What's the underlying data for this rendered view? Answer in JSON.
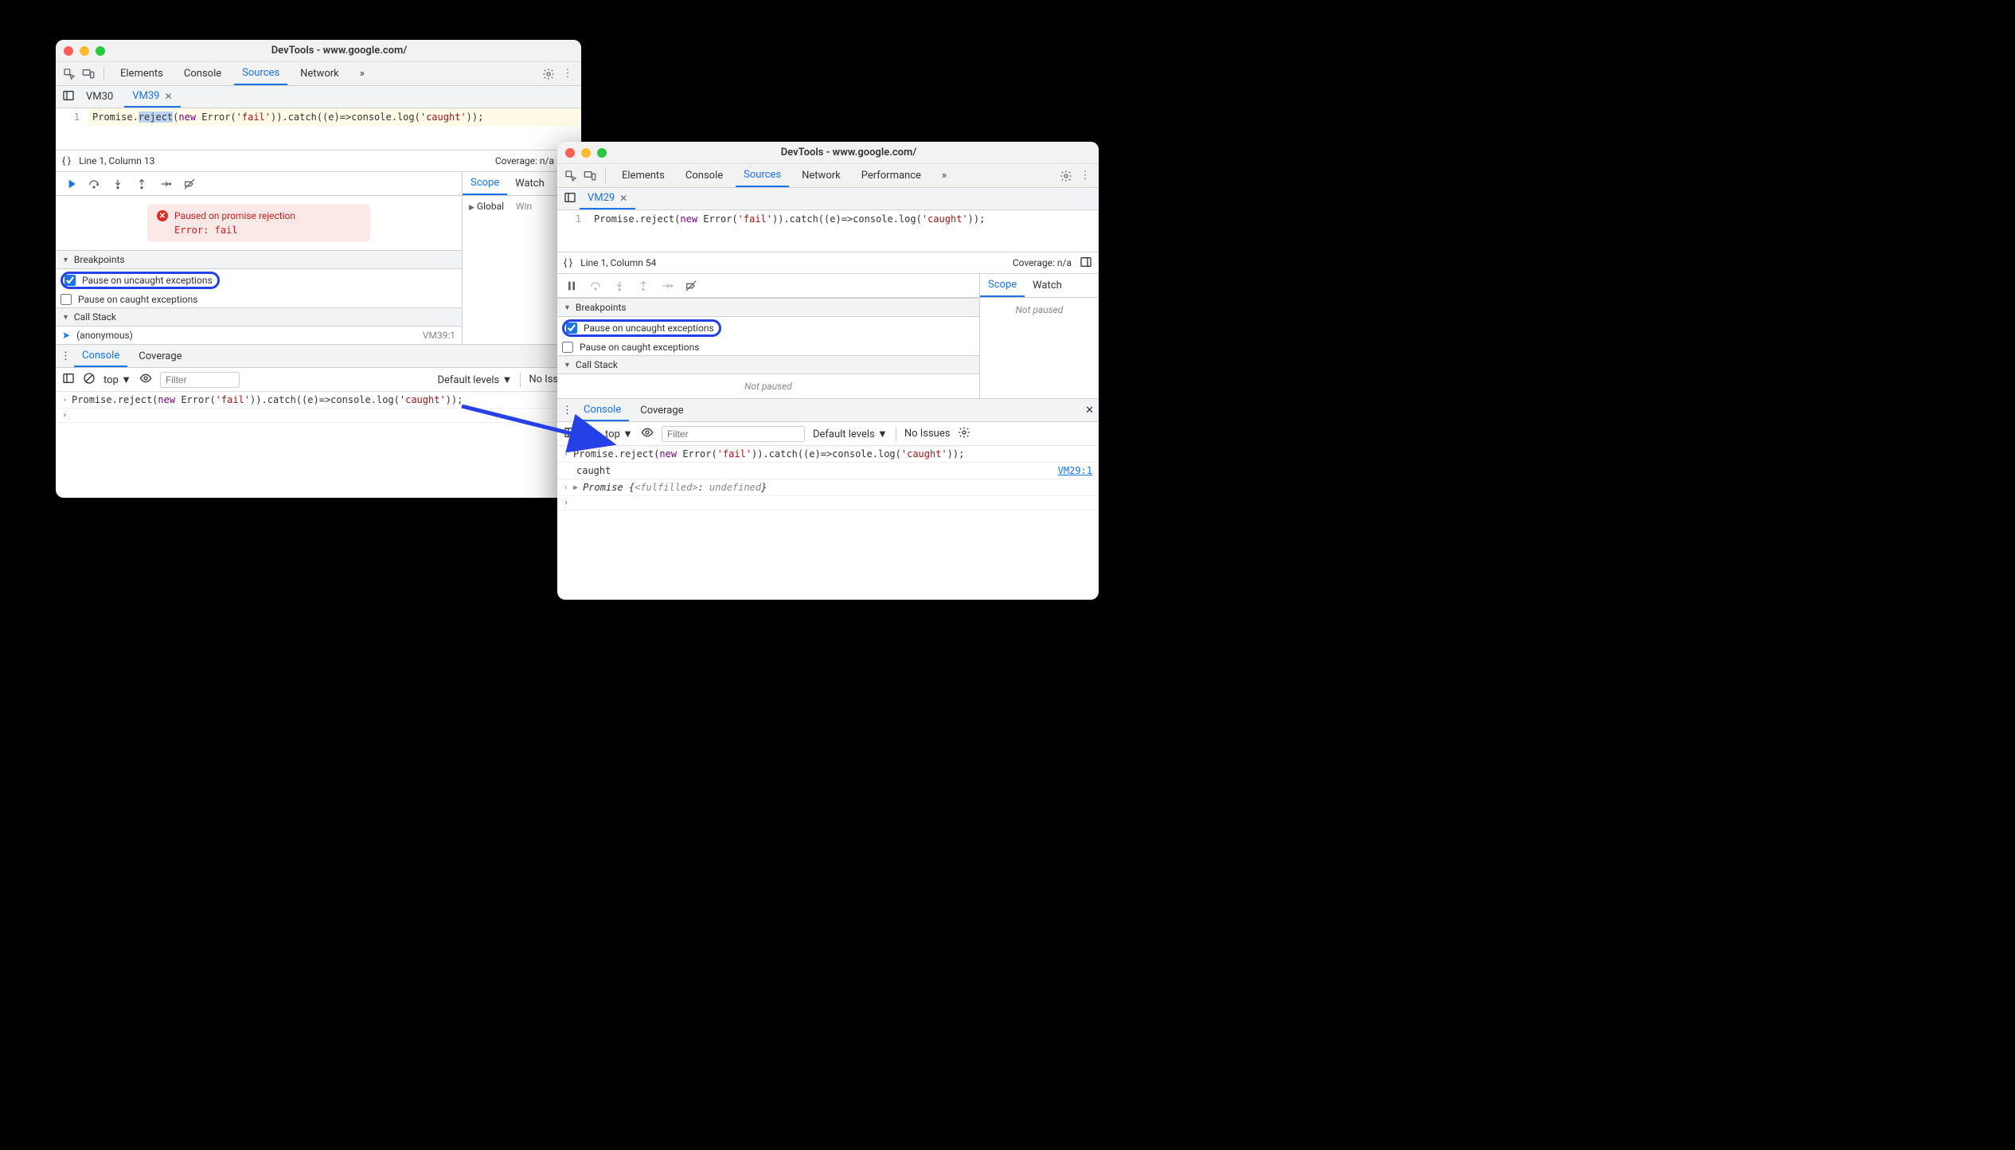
{
  "left": {
    "title": "DevTools - www.google.com/",
    "tabs": [
      "Elements",
      "Console",
      "Sources",
      "Network"
    ],
    "active_tab": "Sources",
    "more_glyph": "»",
    "file_tabs": {
      "inactive": "VM30",
      "active": "VM39"
    },
    "code": {
      "line_no": "1",
      "segments": {
        "a": "Promise.",
        "reject_sel": "reject",
        "b": "(",
        "new": "new",
        "c": " Error(",
        "str1": "'fail'",
        "d": ")).catch((e)=>console.log(",
        "str2": "'caught'",
        "e": "));"
      }
    },
    "status": {
      "cursor": "Line 1, Column 13",
      "coverage": "Coverage: n/a"
    },
    "pause_msg": {
      "head": "Paused on promise rejection",
      "detail": "Error: fail"
    },
    "breakpoints": {
      "heading": "Breakpoints",
      "uncaught": "Pause on uncaught exceptions",
      "caught": "Pause on caught exceptions"
    },
    "callstack": {
      "heading": "Call Stack",
      "frame": "(anonymous)",
      "loc": "VM39:1"
    },
    "scope": {
      "tabs": [
        "Scope",
        "Watch"
      ],
      "global": "Global",
      "win": "Win"
    },
    "drawer": {
      "tabs": [
        "Console",
        "Coverage"
      ]
    },
    "console_tb": {
      "ctx": "top",
      "filter_ph": "Filter",
      "levels": "Default levels",
      "issues": "No Issues"
    },
    "console": {
      "segments": {
        "a": "Promise.reject(",
        "new": "new",
        "b": " Error(",
        "str1": "'fail'",
        "c": ")).catch((e)=>console.log(",
        "str2": "'caught'",
        "d": "));"
      }
    }
  },
  "right": {
    "title": "DevTools - www.google.com/",
    "tabs": [
      "Elements",
      "Console",
      "Sources",
      "Network",
      "Performance"
    ],
    "active_tab": "Sources",
    "more_glyph": "»",
    "file_tabs": {
      "active": "VM29"
    },
    "code": {
      "line_no": "1",
      "segments": {
        "a": "Promise.reject(",
        "new": "new",
        "b": " Error(",
        "str1": "'fail'",
        "c": ")).catch((e)=>console.log(",
        "str2": "'caught'",
        "d": "));"
      }
    },
    "status": {
      "cursor": "Line 1, Column 54",
      "coverage": "Coverage: n/a"
    },
    "breakpoints": {
      "heading": "Breakpoints",
      "uncaught": "Pause on uncaught exceptions",
      "caught": "Pause on caught exceptions"
    },
    "callstack": {
      "heading": "Call Stack",
      "not_paused": "Not paused"
    },
    "scope": {
      "tabs": [
        "Scope",
        "Watch"
      ],
      "not_paused": "Not paused"
    },
    "drawer": {
      "tabs": [
        "Console",
        "Coverage"
      ]
    },
    "console_tb": {
      "ctx": "top",
      "filter_ph": "Filter",
      "levels": "Default levels",
      "issues": "No Issues"
    },
    "console": {
      "row1": {
        "a": "Promise.reject(",
        "new": "new",
        "b": " Error(",
        "str1": "'fail'",
        "c": ")).catch((e)=>console.log(",
        "str2": "'caught'",
        "d": "));"
      },
      "row2_text": "caught",
      "row2_link": "VM29:1",
      "row3": {
        "a": "Promise {",
        "b": "<fulfilled>",
        "c": ": ",
        "d": "undefined",
        "e": "}"
      }
    }
  }
}
